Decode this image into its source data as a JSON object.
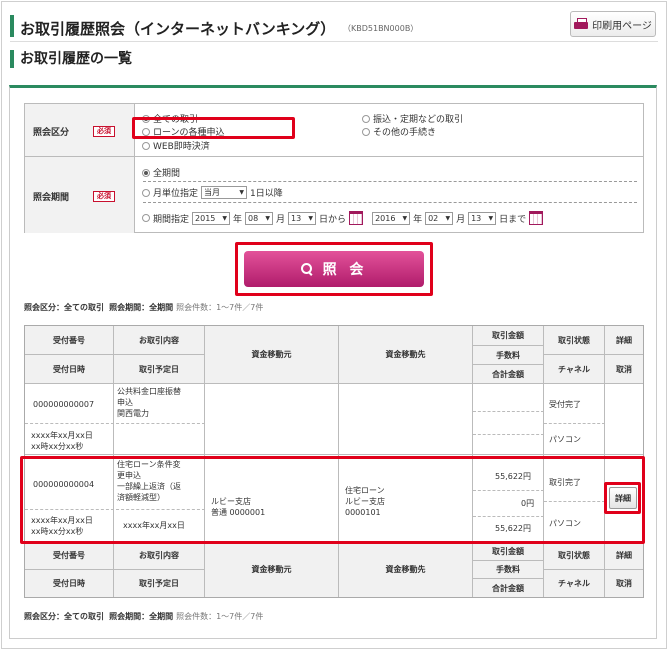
{
  "header": {
    "title": "お取引履歴照会（インターネットバンキング）",
    "screen_code": "（KBD51BN000B）",
    "print_label": "印刷用ページ"
  },
  "section": {
    "title": "お取引履歴の一覧"
  },
  "conditions": {
    "type_label": "照会区分",
    "period_label": "照会期間",
    "required_label": "必須",
    "type_options": [
      "全ての取引",
      "ローンの各種申込",
      "WEB即時決済",
      "振込・定期などの取引",
      "その他の手続き"
    ],
    "period_options": {
      "all": "全期間",
      "month_label": "月単位指定",
      "month_value": "当月",
      "month_suffix": "1日以降",
      "range_label": "期間指定"
    },
    "range": {
      "from_year": "2015",
      "from_month": "08",
      "from_day": "13",
      "to_year": "2016",
      "to_month": "02",
      "to_day": "13",
      "y": "年",
      "m": "月",
      "d_from": "日から",
      "d_to": "日まで"
    }
  },
  "search_label": "照 会",
  "summary": {
    "type_key": "照会区分：",
    "type_val": "全ての取引",
    "period_key": "照会期間：",
    "period_val": "全期間",
    "count": "照会件数：1〜7件／7件"
  },
  "columns": {
    "rec_no": "受付番号",
    "rec_date": "受付日時",
    "content": "お取引内容",
    "sched_date": "取引予定日",
    "src": "資金移動元",
    "dst": "資金移動先",
    "amount": "取引金額",
    "fee": "手数料",
    "total": "合計金額",
    "status": "取引状態",
    "channel": "チャネル",
    "detail": "詳細",
    "cancel": "取消"
  },
  "rows": [
    {
      "no": "000000000007",
      "content": [
        "公共料金口座振替",
        "申込",
        "関西電力"
      ],
      "date": [
        "xxxx年xx月xx日",
        "xx時xx分xx秒"
      ],
      "status": "受付完了",
      "channel": "パソコン"
    },
    {
      "no": "000000000004",
      "content": [
        "住宅ローン条件変",
        "更申込",
        "一部繰上返済（返",
        "済額軽減型）"
      ],
      "date": [
        "xxxx年xx月xx日",
        "xx時xx分xx秒"
      ],
      "sched": "xxxx年xx月xx日",
      "src": [
        "ルビー支店",
        "普通 0000001"
      ],
      "dst": [
        "住宅ローン",
        "ルビー支店",
        "0000101"
      ],
      "amount": "55,622円",
      "fee": "0円",
      "total": "55,622円",
      "status": "取引完了",
      "channel": "パソコン",
      "detail_label": "詳細"
    }
  ]
}
